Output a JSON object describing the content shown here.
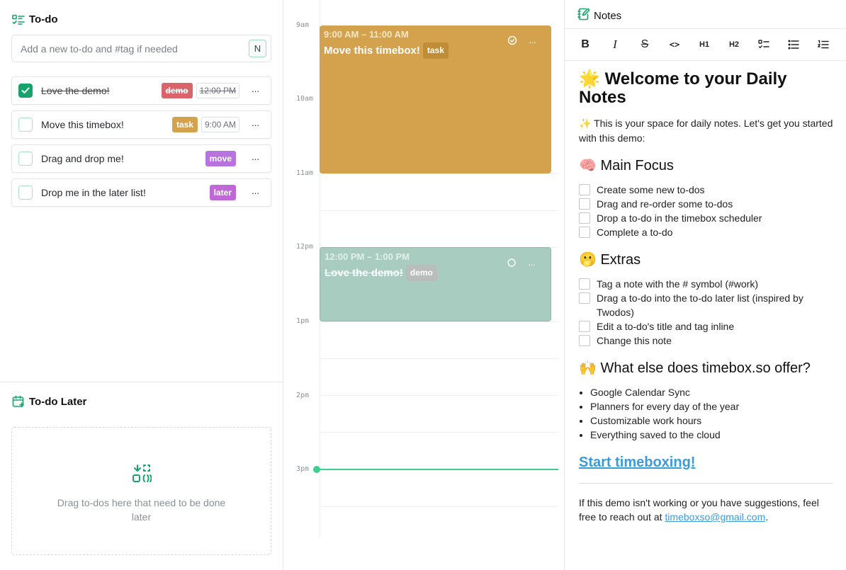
{
  "colors": {
    "accent": "#16a36b",
    "now_line": "#3ecf8e",
    "tag_demo": "#d9646a",
    "tag_task": "#d4a24c",
    "tag_move": "#b874de",
    "tag_later": "#c069d6",
    "timebox_task_bg": "#d4a24c",
    "timebox_demo_bg": "#a8ccbf",
    "link": "#3b9bd8"
  },
  "todo": {
    "title": "To-do",
    "icon": "checklist-icon",
    "input_placeholder": "Add a new to-do and #tag if needed",
    "shortcut_key": "N",
    "items": [
      {
        "title": "Love the demo!",
        "done": true,
        "tag": "demo",
        "time": "12:00 PM"
      },
      {
        "title": "Move this timebox!",
        "done": false,
        "tag": "task",
        "time": "9:00 AM"
      },
      {
        "title": "Drag and drop me!",
        "done": false,
        "tag": "move",
        "time": ""
      },
      {
        "title": "Drop me in the later list!",
        "done": false,
        "tag": "later",
        "time": ""
      }
    ],
    "more_label": "···"
  },
  "later": {
    "title": "To-do Later",
    "icon": "calendar-plus-icon",
    "drop_icon": "drag-move-icon",
    "hint": "Drag to-dos here that need to be done later"
  },
  "schedule": {
    "hours": [
      "9am",
      "10am",
      "11am",
      "12pm",
      "1pm",
      "2pm",
      "3pm"
    ],
    "timeboxes": [
      {
        "time": "9:00 AM – 11:00 AM",
        "title": "Move this timebox!",
        "tag": "task",
        "done": false
      },
      {
        "time": "12:00 PM – 1:00 PM",
        "title": "Love the demo!",
        "tag": "demo",
        "done": true
      }
    ],
    "more_label": "···"
  },
  "notes": {
    "title": "Notes",
    "icon": "notebook-pen-icon",
    "toolbar": {
      "bold": "B",
      "italic": "I",
      "strike": "S",
      "code": "<>",
      "h1": "H1",
      "h2": "H2",
      "tasklist": "checklist-icon",
      "bullets": "bullet-list-icon",
      "numbered": "numbered-list-icon"
    },
    "heading_emoji": "🌟",
    "heading": "Welcome to your Daily Notes",
    "intro_emoji": "✨",
    "intro": "This is your space for daily notes. Let's get you started with this demo:",
    "focus_emoji": "🧠",
    "focus_title": "Main Focus",
    "focus_items": [
      "Create some new to-dos",
      "Drag and re-order some to-dos",
      "Drop a to-do in the timebox scheduler",
      "Complete a to-do"
    ],
    "extras_emoji": "🫢",
    "extras_title": "Extras",
    "extras_items": [
      "Tag a note with the # symbol (#work)",
      "Drag a to-do into the to-do later list (inspired by Twodos)",
      "Edit a to-do's title and tag inline",
      "Change this note"
    ],
    "offer_emoji": "🙌",
    "offer_title": "What else does timebox.so offer?",
    "offer_items": [
      "Google Calendar Sync",
      "Planners for every day of the year",
      "Customizable work hours",
      "Everything saved to the cloud"
    ],
    "cta": "Start timeboxing!",
    "footer_text": "If this demo isn't working or you have suggestions, feel free to reach out at",
    "footer_email": "timeboxso@gmail.com",
    "footer_end": "."
  }
}
